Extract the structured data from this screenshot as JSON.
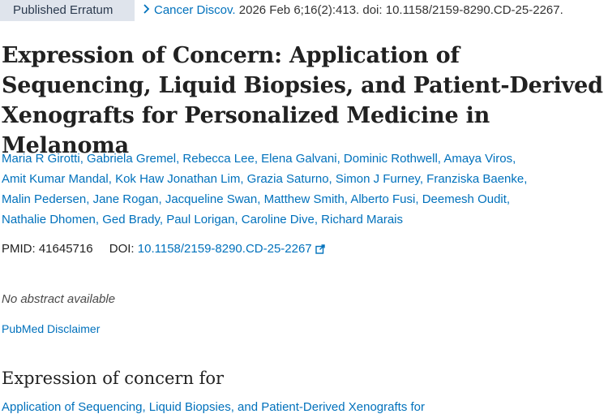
{
  "header": {
    "badge": "Published Erratum",
    "citation_journal": "Cancer Discov.",
    "citation_rest": " 2026 Feb 6;16(2):413. doi: 10.1158/2159-8290.CD-25-2267."
  },
  "title": "Expression of Concern: Application of Sequencing, Liquid Biopsies, and Patient-Derived Xenografts for Personalized Medicine in Melanoma",
  "authors": [
    "Maria R Girotti",
    "Gabriela Gremel",
    "Rebecca Lee",
    "Elena Galvani",
    "Dominic Rothwell",
    "Amaya Viros",
    "Amit Kumar Mandal",
    "Kok Haw Jonathan Lim",
    "Grazia Saturno",
    "Simon J Furney",
    "Franziska Baenke",
    "Malin Pedersen",
    "Jane Rogan",
    "Jacqueline Swan",
    "Matthew Smith",
    "Alberto Fusi",
    "Deemesh Oudit",
    "Nathalie Dhomen",
    "Ged Brady",
    "Paul Lorigan",
    "Caroline Dive",
    "Richard Marais"
  ],
  "ids": {
    "pmid_label": "PMID: 41645716",
    "doi_label": "DOI:",
    "doi_value": "10.1158/2159-8290.CD-25-2267"
  },
  "no_abstract": "No abstract available",
  "disclaimer": "PubMed Disclaimer",
  "section_heading": "Expression of concern for",
  "related_article": "Application of Sequencing, Liquid Biopsies, and Patient-Derived Xenografts for"
}
